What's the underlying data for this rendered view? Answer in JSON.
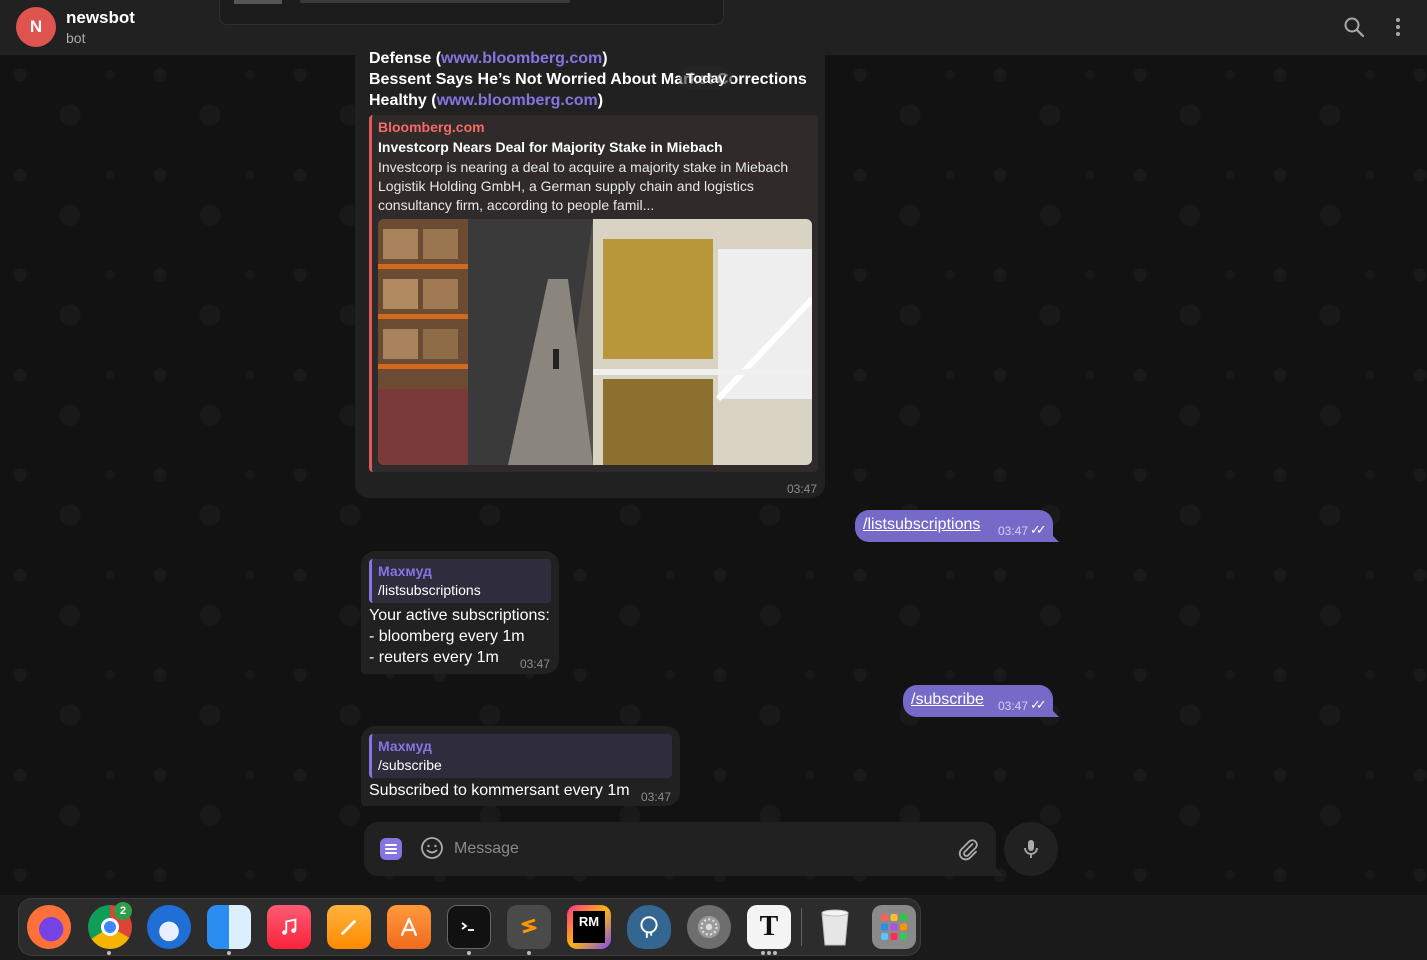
{
  "header": {
    "avatar_letter": "N",
    "title": "newsbot",
    "subtitle": "bot",
    "icons": [
      "search-icon",
      "more-vertical-icon"
    ]
  },
  "date_divider": "Today",
  "messages": [
    {
      "type": "incoming",
      "lines": [
        {
          "text": "Defense (",
          "link": "www.bloomberg.com",
          "tail": ")"
        },
        {
          "text": "Bessent Says He’s Not Worried About Market Corrections"
        },
        {
          "text": "Healthy (",
          "link": "www.bloomberg.com",
          "tail": ")"
        }
      ],
      "preview": {
        "site": "Bloomberg.com",
        "title": "Investcorp Nears Deal for Majority Stake in Miebach",
        "description": "Investcorp is nearing a deal to acquire a majority stake in Miebach Logistik Holding GmbH, a German supply chain and logistics consultancy firm, according to people famil..."
      },
      "time": "03:47"
    },
    {
      "type": "outgoing",
      "text": "/listsubscriptions",
      "time": "03:47"
    },
    {
      "type": "incoming",
      "reply_name": "Махмуд",
      "reply_text": "/listsubscriptions",
      "lines": [
        "Your active subscriptions:",
        "- bloomberg every 1m",
        "- reuters every 1m"
      ],
      "time": "03:47"
    },
    {
      "type": "outgoing",
      "text": "/subscribe",
      "time": "03:47"
    },
    {
      "type": "incoming",
      "reply_name": "Махмуд",
      "reply_text": "/subscribe",
      "lines": [
        "Subscribed to kommersant every 1m"
      ],
      "time": "03:47"
    }
  ],
  "composer": {
    "placeholder": "Message"
  },
  "dock": {
    "badge_count": "2",
    "rm_label": "RM",
    "t_label": "T",
    "items": [
      "firefox-icon",
      "chrome-icon",
      "thunderbird-icon",
      "finder-icon",
      "music-icon",
      "pages-icon",
      "app-store-icon",
      "terminal-icon",
      "sublime-text-icon",
      "rubymine-icon",
      "postgresql-icon",
      "system-settings-icon",
      "typora-icon",
      "trash-icon",
      "launchpad-icon"
    ]
  },
  "colors": {
    "accent": "#8774e1",
    "outgoing_bubble": "#766ac8",
    "incoming_bubble": "#212121",
    "preview_accent": "#e05a57"
  }
}
